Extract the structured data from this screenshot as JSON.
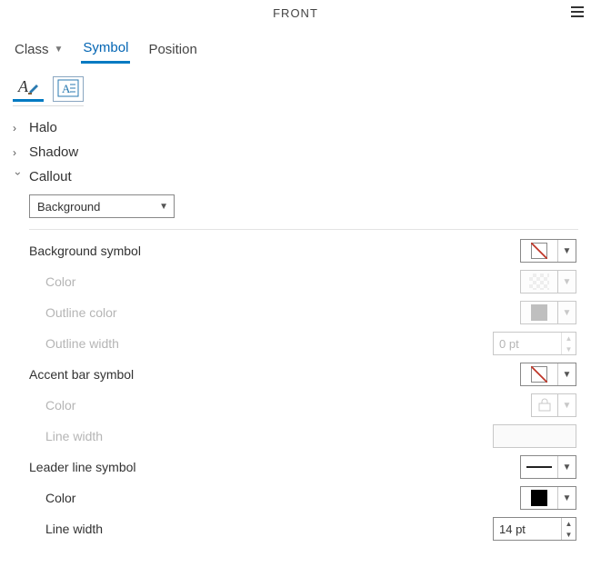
{
  "header": {
    "title": "FRONT"
  },
  "tabs": {
    "class": "Class",
    "symbol": "Symbol",
    "position": "Position",
    "active": "symbol"
  },
  "groups": {
    "halo": {
      "label": "Halo",
      "expanded": false
    },
    "shadow": {
      "label": "Shadow",
      "expanded": false
    },
    "callout": {
      "label": "Callout",
      "expanded": true
    }
  },
  "callout": {
    "type_value": "Background",
    "background_symbol": {
      "label": "Background symbol",
      "swatch": "no-fill",
      "color": {
        "label": "Color",
        "enabled": false
      },
      "outline_color": {
        "label": "Outline color",
        "enabled": false
      },
      "outline_width": {
        "label": "Outline width",
        "value": "0 pt",
        "enabled": false
      }
    },
    "accent_bar_symbol": {
      "label": "Accent bar symbol",
      "swatch": "no-fill",
      "color": {
        "label": "Color",
        "enabled": false
      },
      "line_width": {
        "label": "Line width",
        "value": "",
        "enabled": false
      }
    },
    "leader_line_symbol": {
      "label": "Leader line symbol",
      "swatch": "line",
      "color": {
        "label": "Color",
        "value": "#000000",
        "enabled": true
      },
      "line_width": {
        "label": "Line width",
        "value": "14 pt",
        "enabled": true
      }
    }
  }
}
